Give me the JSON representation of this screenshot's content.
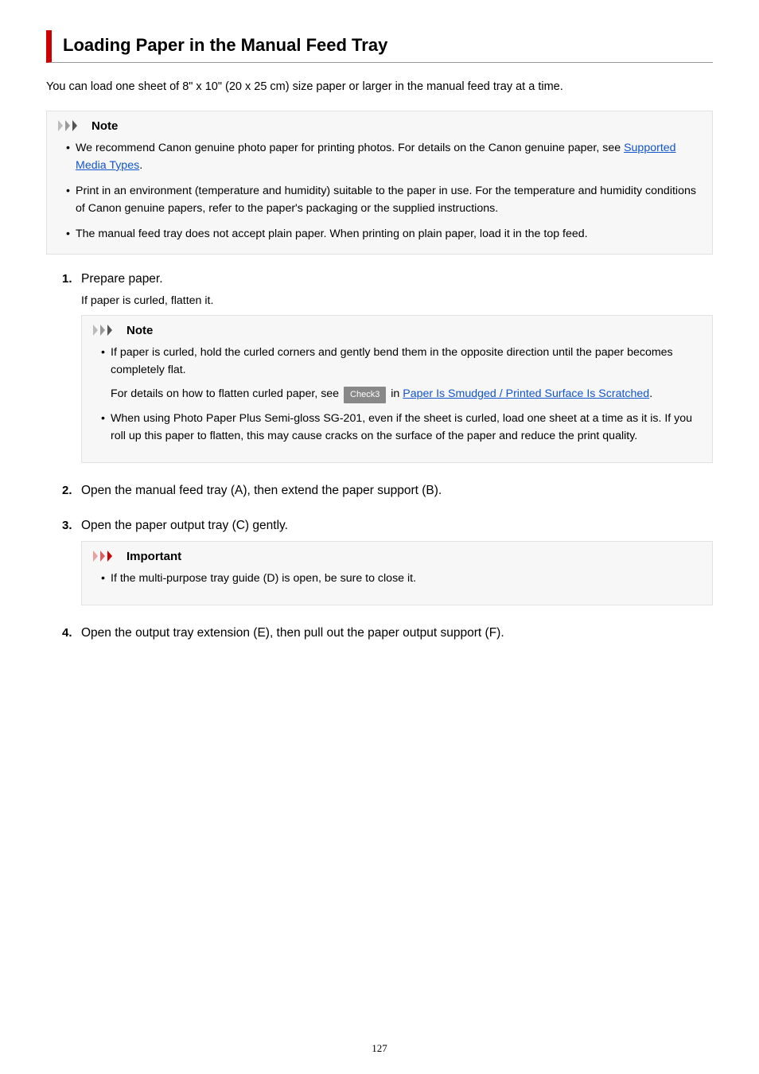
{
  "title": "Loading Paper in the Manual Feed Tray",
  "intro": "You can load one sheet of 8\" x 10\" (20 x 25 cm) size paper or larger in the manual feed tray at a time.",
  "note_label": "Note",
  "important_label": "Important",
  "notes": [
    {
      "pre": "We recommend Canon genuine photo paper for printing photos. For details on the Canon genuine paper, see ",
      "link": "Supported Media Types",
      "post": "."
    },
    {
      "text": "Print in an environment (temperature and humidity) suitable to the paper in use. For the temperature and humidity conditions of Canon genuine papers, refer to the paper's packaging or the supplied instructions."
    },
    {
      "text": "The manual feed tray does not accept plain paper. When printing on plain paper, load it in the top feed."
    }
  ],
  "steps": {
    "s1": {
      "num": "1.",
      "title": "Prepare paper.",
      "sub": "If paper is curled, flatten it.",
      "note_items": {
        "i1_text": "If paper is curled, hold the curled corners and gently bend them in the opposite direction until the paper becomes completely flat.",
        "i1_para_pre": "For details on how to flatten curled paper, see ",
        "i1_check": "Check3",
        "i1_para_mid": " in ",
        "i1_link": "Paper Is Smudged / Printed Surface Is Scratched",
        "i1_para_post": ".",
        "i2_text": "When using Photo Paper Plus Semi-gloss SG-201, even if the sheet is curled, load one sheet at a time as it is. If you roll up this paper to flatten, this may cause cracks on the surface of the paper and reduce the print quality."
      }
    },
    "s2": {
      "num": "2.",
      "title": "Open the manual feed tray (A), then extend the paper support (B)."
    },
    "s3": {
      "num": "3.",
      "title": "Open the paper output tray (C) gently.",
      "important_text": "If the multi-purpose tray guide (D) is open, be sure to close it."
    },
    "s4": {
      "num": "4.",
      "title": "Open the output tray extension (E), then pull out the paper output support (F)."
    }
  },
  "page_number": "127"
}
